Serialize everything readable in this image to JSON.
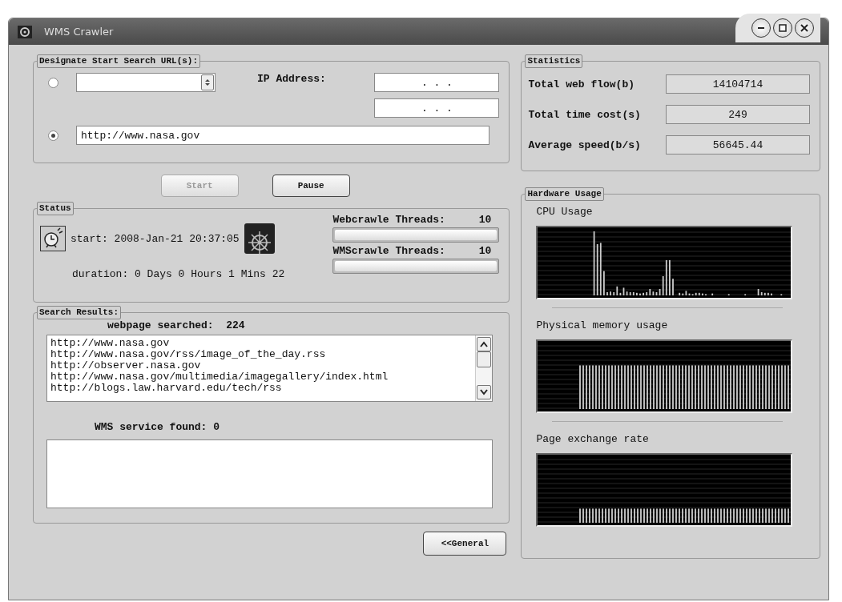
{
  "window": {
    "title": "WMS Crawler"
  },
  "start_urls": {
    "title": "Designate Start Search URL(s):",
    "options": [
      {
        "kind": "combo",
        "selected": false
      },
      {
        "kind": "text",
        "selected": true,
        "value": "http://www.nasa.gov"
      }
    ],
    "ip_label": "IP Address:",
    "ip_fields": [
      ". . .",
      ". . ."
    ]
  },
  "buttons": [
    {
      "label": "Start",
      "disabled": true
    },
    {
      "label": "Pause",
      "disabled": false
    }
  ],
  "status": {
    "title": "Status",
    "start": "start: 2008-Jan-21 20:37:05",
    "duration": "duration: 0 Days 0 Hours 1 Mins 22",
    "threads": [
      {
        "label": "Webcrawle Threads:",
        "value": "10",
        "level": 1
      },
      {
        "label": "WMScrawle Threads:",
        "value": "10",
        "level": 1
      }
    ]
  },
  "search_results": {
    "title": "Search Results:",
    "searched_label": "webpage searched:  224",
    "urls": [
      "http://www.nasa.gov",
      "http://www.nasa.gov/rss/image_of_the_day.rss",
      "http://observer.nasa.gov",
      "http://www.nasa.gov/multimedia/imagegallery/index.html",
      "http://blogs.law.harvard.edu/tech/rss"
    ],
    "wms_label": "WMS service found: 0"
  },
  "general_button": "<<General",
  "statistics": {
    "title": "Statistics",
    "rows": [
      {
        "label": "Total web flow(b)",
        "value": "14104714"
      },
      {
        "label": "Total time cost(s)",
        "value": "249"
      },
      {
        "label": "Average speed(b/s)",
        "value": "56645.44"
      }
    ]
  },
  "hardware": {
    "title": "Hardware Usage",
    "graphs": [
      {
        "kind": "spiky",
        "label": "CPU Usage"
      },
      {
        "kind": "flat",
        "label": "Physical memory usage"
      },
      {
        "kind": "low",
        "label": "Page exchange rate"
      }
    ]
  }
}
